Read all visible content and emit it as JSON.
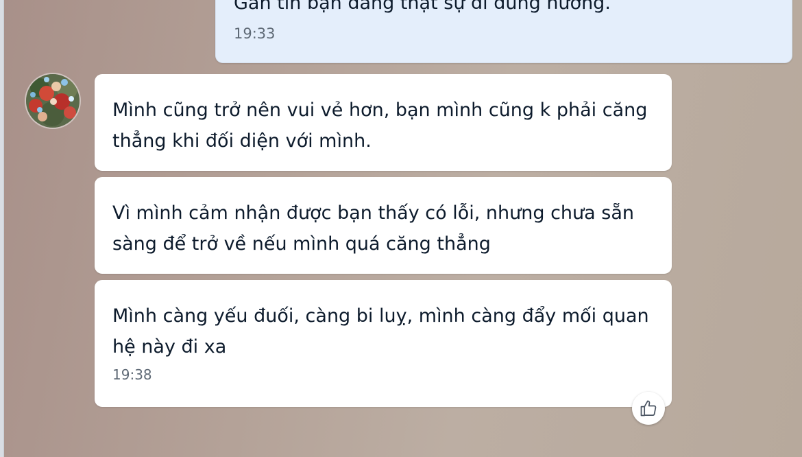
{
  "conversation": {
    "outgoing": {
      "text": "Gần tin bạn đang thật sự đi đúng hướng.",
      "time": "19:33"
    },
    "incoming": {
      "messages": [
        {
          "text": "Mình cũng trở nên vui vẻ hơn, bạn mình cũng k phải căng thẳng khi đối diện với mình."
        },
        {
          "text": "Vì mình cảm nhận được bạn thấy có lỗi, nhưng chưa sẵn sàng để trở về nếu mình quá căng thẳng"
        },
        {
          "text": "Mình càng yếu đuối, càng bi luỵ, mình càng đẩy mối quan hệ này đi xa",
          "time": "19:38"
        }
      ]
    }
  },
  "icons": {
    "avatar": "flower-bouquet-avatar",
    "reaction": "thumbs-up-icon"
  },
  "colors": {
    "outgoing_bubble": "#e4eefb",
    "incoming_bubble": "#ffffff",
    "text": "#0d1b2c",
    "timestamp": "#5e6975"
  }
}
